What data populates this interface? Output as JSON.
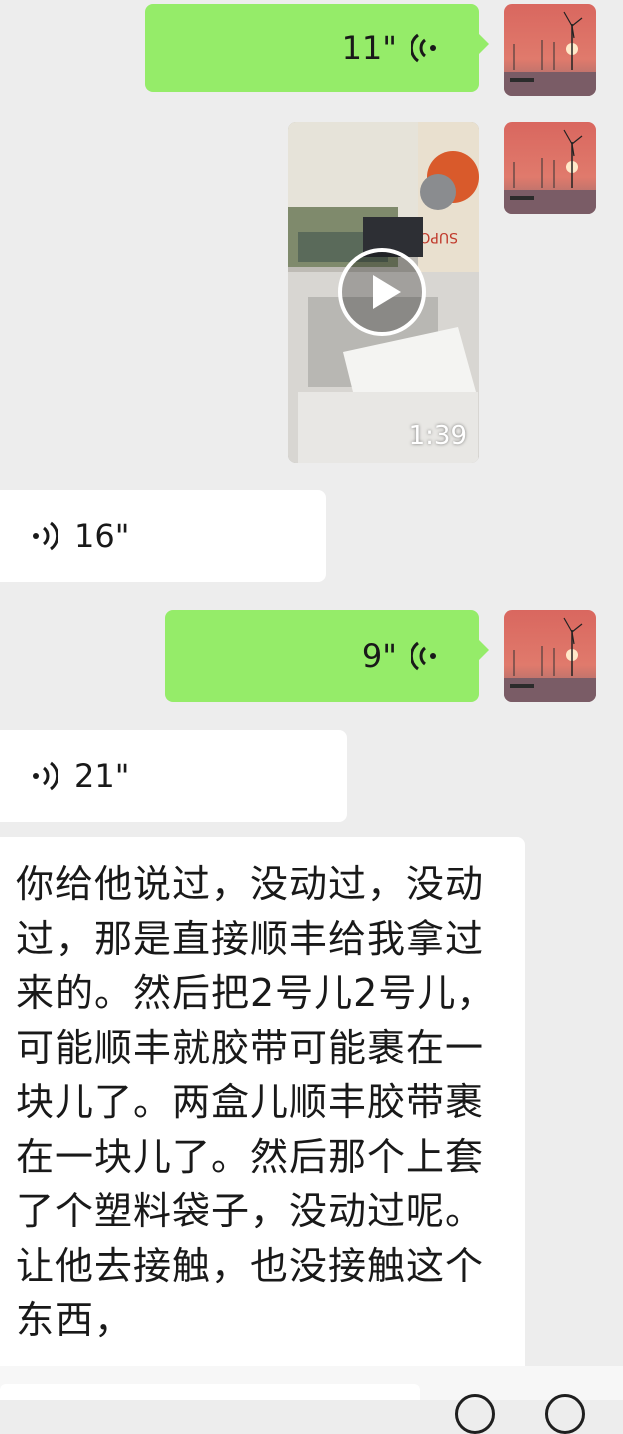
{
  "messages": [
    {
      "side": "me",
      "type": "voice",
      "duration": "11\""
    },
    {
      "side": "me",
      "type": "video",
      "duration": "1:39"
    },
    {
      "side": "other",
      "type": "voice",
      "duration": "16\""
    },
    {
      "side": "me",
      "type": "voice",
      "duration": "9\""
    },
    {
      "side": "other",
      "type": "voice",
      "duration": "21\""
    },
    {
      "side": "other",
      "type": "text",
      "text": "你给他说过，没动过，没动过，那是直接顺丰给我拿过来的。然后把2号儿2号儿，可能顺丰就胶带可能裹在一块儿了。两盒儿顺丰胶带裹在一块儿了。然后那个上套了个塑料袋子，没动过呢。让他去接触，也没接触这个东西，"
    }
  ],
  "icons": {
    "voice": "voice-wave-icon",
    "play": "play-icon",
    "avatar": "avatar-sunset-windmill"
  },
  "colors": {
    "background": "#ededed",
    "my_bubble": "#95ec69",
    "other_bubble": "#ffffff",
    "text": "#191919"
  }
}
